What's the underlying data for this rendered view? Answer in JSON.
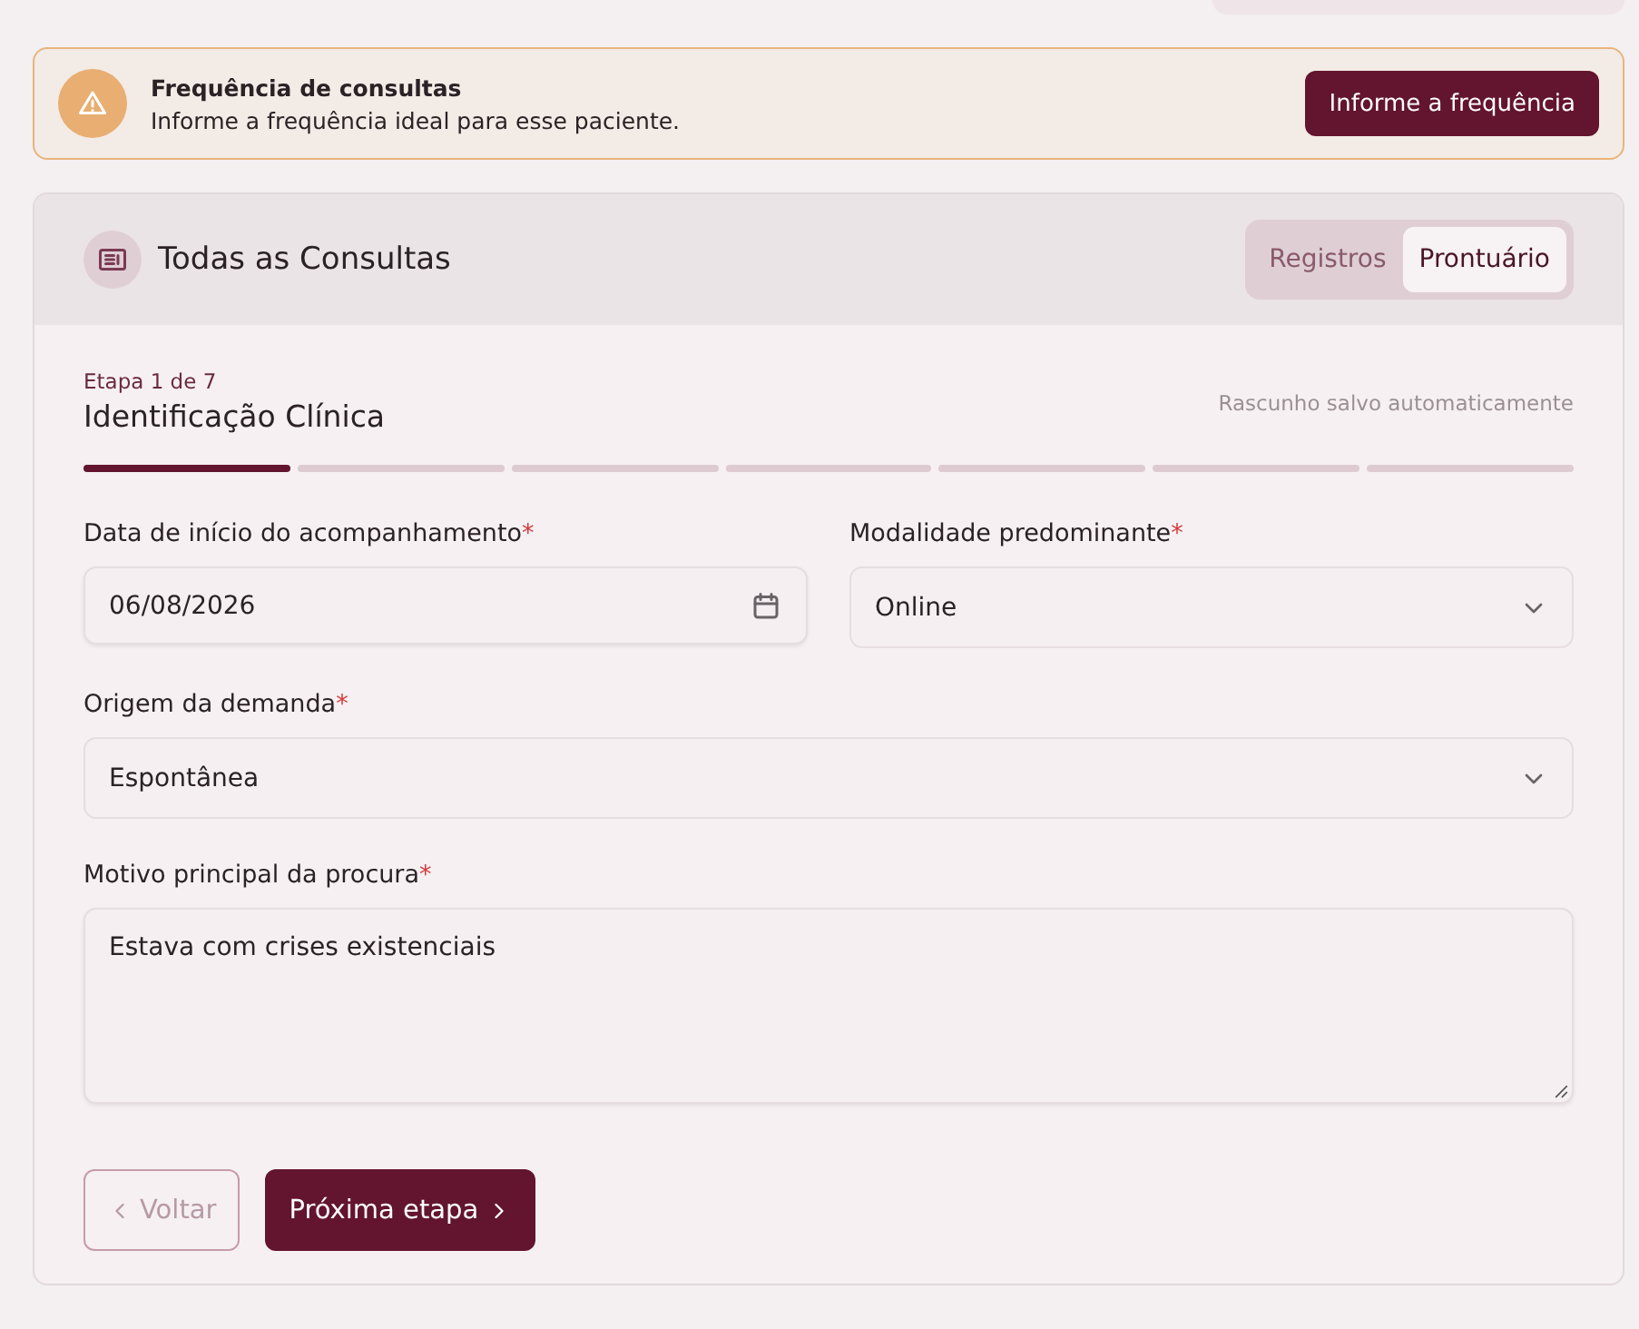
{
  "alert": {
    "title": "Frequência de consultas",
    "message": "Informe a frequência ideal para esse paciente.",
    "action": "Informe a frequência"
  },
  "card": {
    "title": "Todas as Consultas",
    "tabs": [
      {
        "label": "Registros",
        "selected": false
      },
      {
        "label": "Prontuário",
        "selected": true
      }
    ],
    "step_label": "Etapa 1 de 7",
    "step_title": "Identificação Clínica",
    "autosave": "Rascunho salvo automaticamente",
    "progress": [
      {
        "completed": true
      },
      {
        "completed": false
      },
      {
        "completed": false
      },
      {
        "completed": false
      },
      {
        "completed": false
      },
      {
        "completed": false
      },
      {
        "completed": false
      }
    ],
    "field_rows": [
      [
        {
          "kind": "date",
          "label": "Data de início do acompanhamento",
          "required_mark": "*",
          "value": "06/08/2026"
        },
        {
          "kind": "select",
          "label": "Modalidade predominante",
          "required_mark": "*",
          "value": "Online"
        }
      ],
      [
        {
          "kind": "select",
          "label": "Origem da demanda",
          "required_mark": "*",
          "value": "Espontânea"
        }
      ],
      [
        {
          "kind": "textarea",
          "label": "Motivo principal da procura",
          "required_mark": "*",
          "value": "Estava com crises existenciais"
        }
      ]
    ],
    "back_button": {
      "label": "Voltar",
      "disabled": true
    },
    "next_button": {
      "label": "Próxima etapa",
      "disabled": false
    }
  }
}
